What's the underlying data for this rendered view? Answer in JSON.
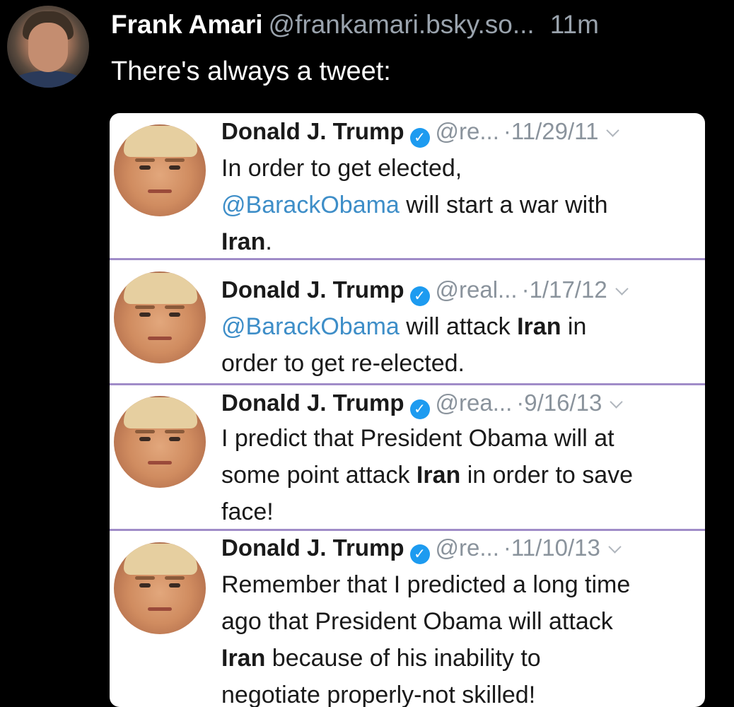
{
  "post": {
    "author_name": "Frank Amari",
    "author_handle": "@frankamari.bsky.so...",
    "time": "11m",
    "text": "There's always a tweet:"
  },
  "colors": {
    "background": "#000000",
    "muted_text": "#9aa3ad",
    "mention": "#3e8ec8",
    "verified": "#1d9bf0",
    "divider": "#a08cc8"
  },
  "tweets": [
    {
      "name": "Donald J. Trump",
      "handle": "@re...",
      "date": "·11/29/11",
      "icon": "verified-icon",
      "lines": [
        [
          {
            "t": "In order to get elected,"
          }
        ],
        [
          {
            "t": "@BarackObama",
            "s": "mention"
          },
          {
            "t": " will start a war with"
          }
        ],
        [
          {
            "t": "Iran",
            "s": "bold"
          },
          {
            "t": "."
          }
        ]
      ]
    },
    {
      "name": "Donald J. Trump",
      "handle": "@real...",
      "date": "·1/17/12",
      "icon": "verified-icon",
      "lines": [
        [
          {
            "t": "@BarackObama",
            "s": "mention"
          },
          {
            "t": " will attack "
          },
          {
            "t": "Iran",
            "s": "bold"
          },
          {
            "t": " in"
          }
        ],
        [
          {
            "t": "order to get re-elected."
          }
        ]
      ]
    },
    {
      "name": "Donald J. Trump",
      "handle": "@rea...",
      "date": "·9/16/13",
      "icon": "verified-icon",
      "lines": [
        [
          {
            "t": "I predict that President Obama will at"
          }
        ],
        [
          {
            "t": "some point attack "
          },
          {
            "t": "Iran",
            "s": "bold"
          },
          {
            "t": " in order to save"
          }
        ],
        [
          {
            "t": "face!"
          }
        ]
      ]
    },
    {
      "name": "Donald J. Trump",
      "handle": "@re...",
      "date": "·11/10/13",
      "icon": "verified-icon",
      "lines": [
        [
          {
            "t": "Remember that I predicted a long time"
          }
        ],
        [
          {
            "t": "ago that President Obama will attack"
          }
        ],
        [
          {
            "t": "Iran",
            "s": "bold"
          },
          {
            "t": " because of his inability to"
          }
        ],
        [
          {
            "t": "negotiate properly-not skilled!"
          }
        ]
      ]
    }
  ]
}
